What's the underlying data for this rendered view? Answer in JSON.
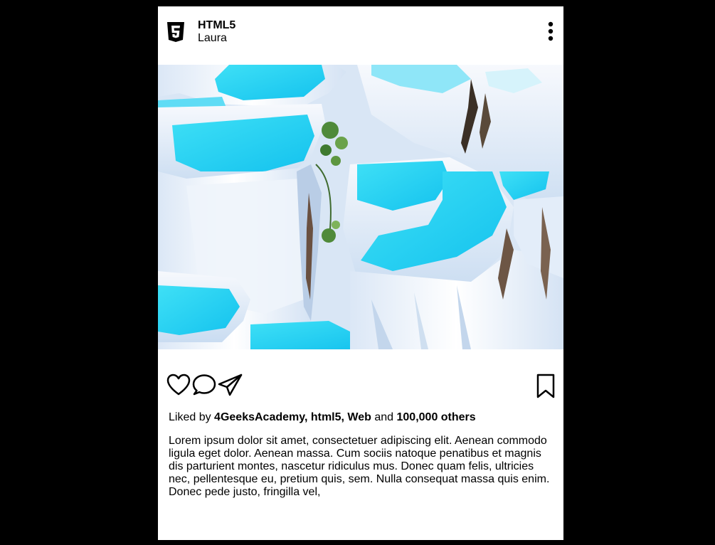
{
  "post": {
    "brand": "HTML5",
    "username": "Laura",
    "logo_icon": "html5-shield-icon",
    "menu_icon": "more-vertical-icon",
    "photo_description": "",
    "actions": {
      "like_icon": "heart-icon",
      "comment_icon": "comment-bubble-icon",
      "share_icon": "paper-plane-icon",
      "save_icon": "bookmark-icon"
    },
    "likes": {
      "prefix": "Liked by",
      "names": "4GeeksAcademy, html5, Web",
      "conjunction": "and",
      "others": "100,000 others"
    },
    "caption": "Lorem ipsum dolor sit amet, consectetuer adipiscing elit. Aenean commodo ligula eget dolor. Aenean massa. Cum sociis natoque penatibus et magnis dis parturient montes, nascetur ridiculus mus. Donec quam felis, ultricies nec, pellentesque eu, pretium quis, sem. Nulla consequat massa quis enim. Donec pede justo, fringilla vel,"
  },
  "colors": {
    "page_background": "#000000",
    "card_background": "#ffffff",
    "text": "#000000",
    "pool_water": "#22d3f0",
    "travertine": "#e9f1fb"
  }
}
